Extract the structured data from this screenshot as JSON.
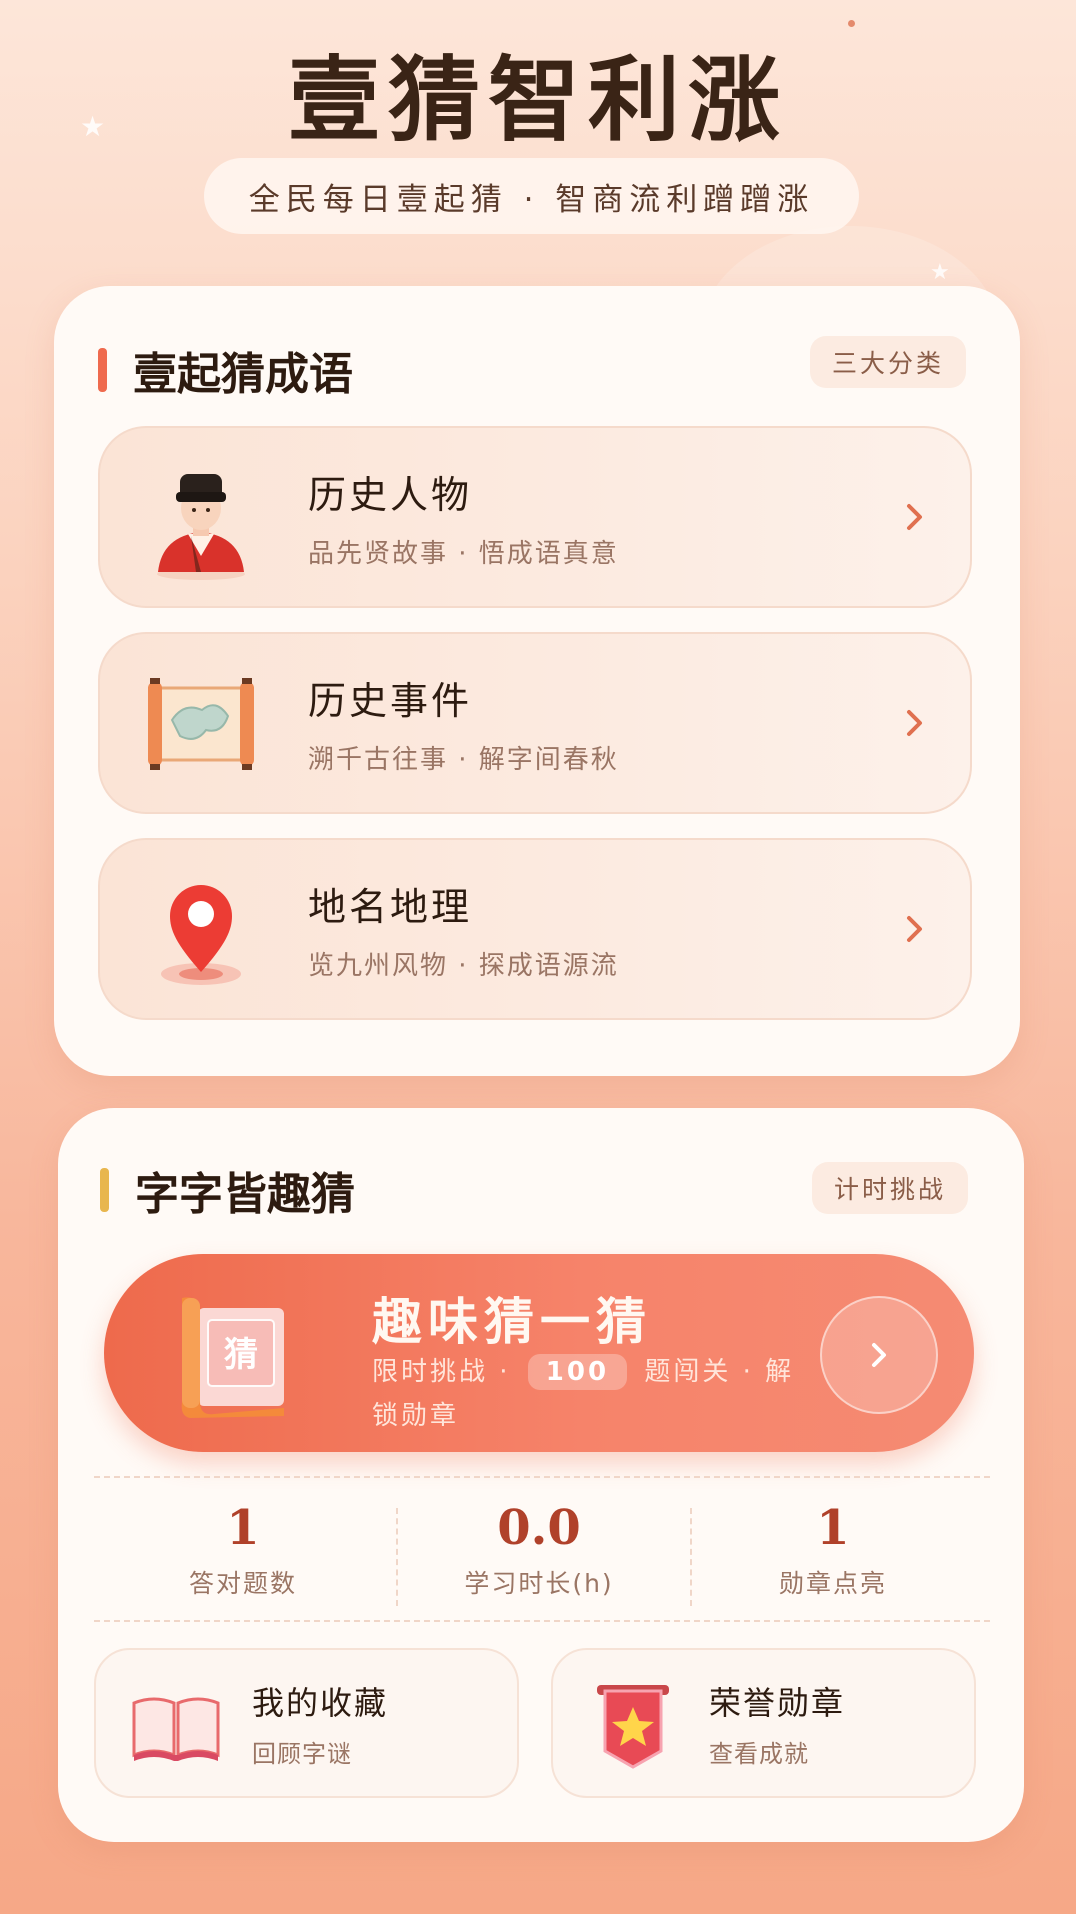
{
  "header": {
    "title": "壹猜智利涨",
    "subtitle": "全民每日壹起猜 · 智商流利蹭蹭涨"
  },
  "idiom_section": {
    "title": "壹起猜成语",
    "tag": "三大分类",
    "accent_color": "#ef6a4e",
    "items": [
      {
        "title": "历史人物",
        "desc": "品先贤故事 · 悟成语真意",
        "icon": "scholar-figure-icon"
      },
      {
        "title": "历史事件",
        "desc": "溯千古往事 · 解字间春秋",
        "icon": "map-scroll-icon"
      },
      {
        "title": "地名地理",
        "desc": "览九州风物 · 探成语源流",
        "icon": "location-pin-icon"
      }
    ]
  },
  "char_section": {
    "title": "字字皆趣猜",
    "tag": "计时挑战",
    "accent_color": "#e8b64e",
    "hero": {
      "title": "趣味猜一猜",
      "desc_prefix": "限时挑战 ·",
      "count": "100",
      "desc_suffix": "题闯关 · 解锁勋章",
      "scroll_char": "猜"
    },
    "stats": [
      {
        "value": "1",
        "label": "答对题数"
      },
      {
        "value": "0.0",
        "label": "学习时长(h)"
      },
      {
        "value": "1",
        "label": "勋章点亮"
      }
    ],
    "shortcuts": [
      {
        "title": "我的收藏",
        "desc": "回顾字谜",
        "icon": "open-book-icon"
      },
      {
        "title": "荣誉勋章",
        "desc": "查看成就",
        "icon": "star-badge-icon"
      }
    ]
  }
}
